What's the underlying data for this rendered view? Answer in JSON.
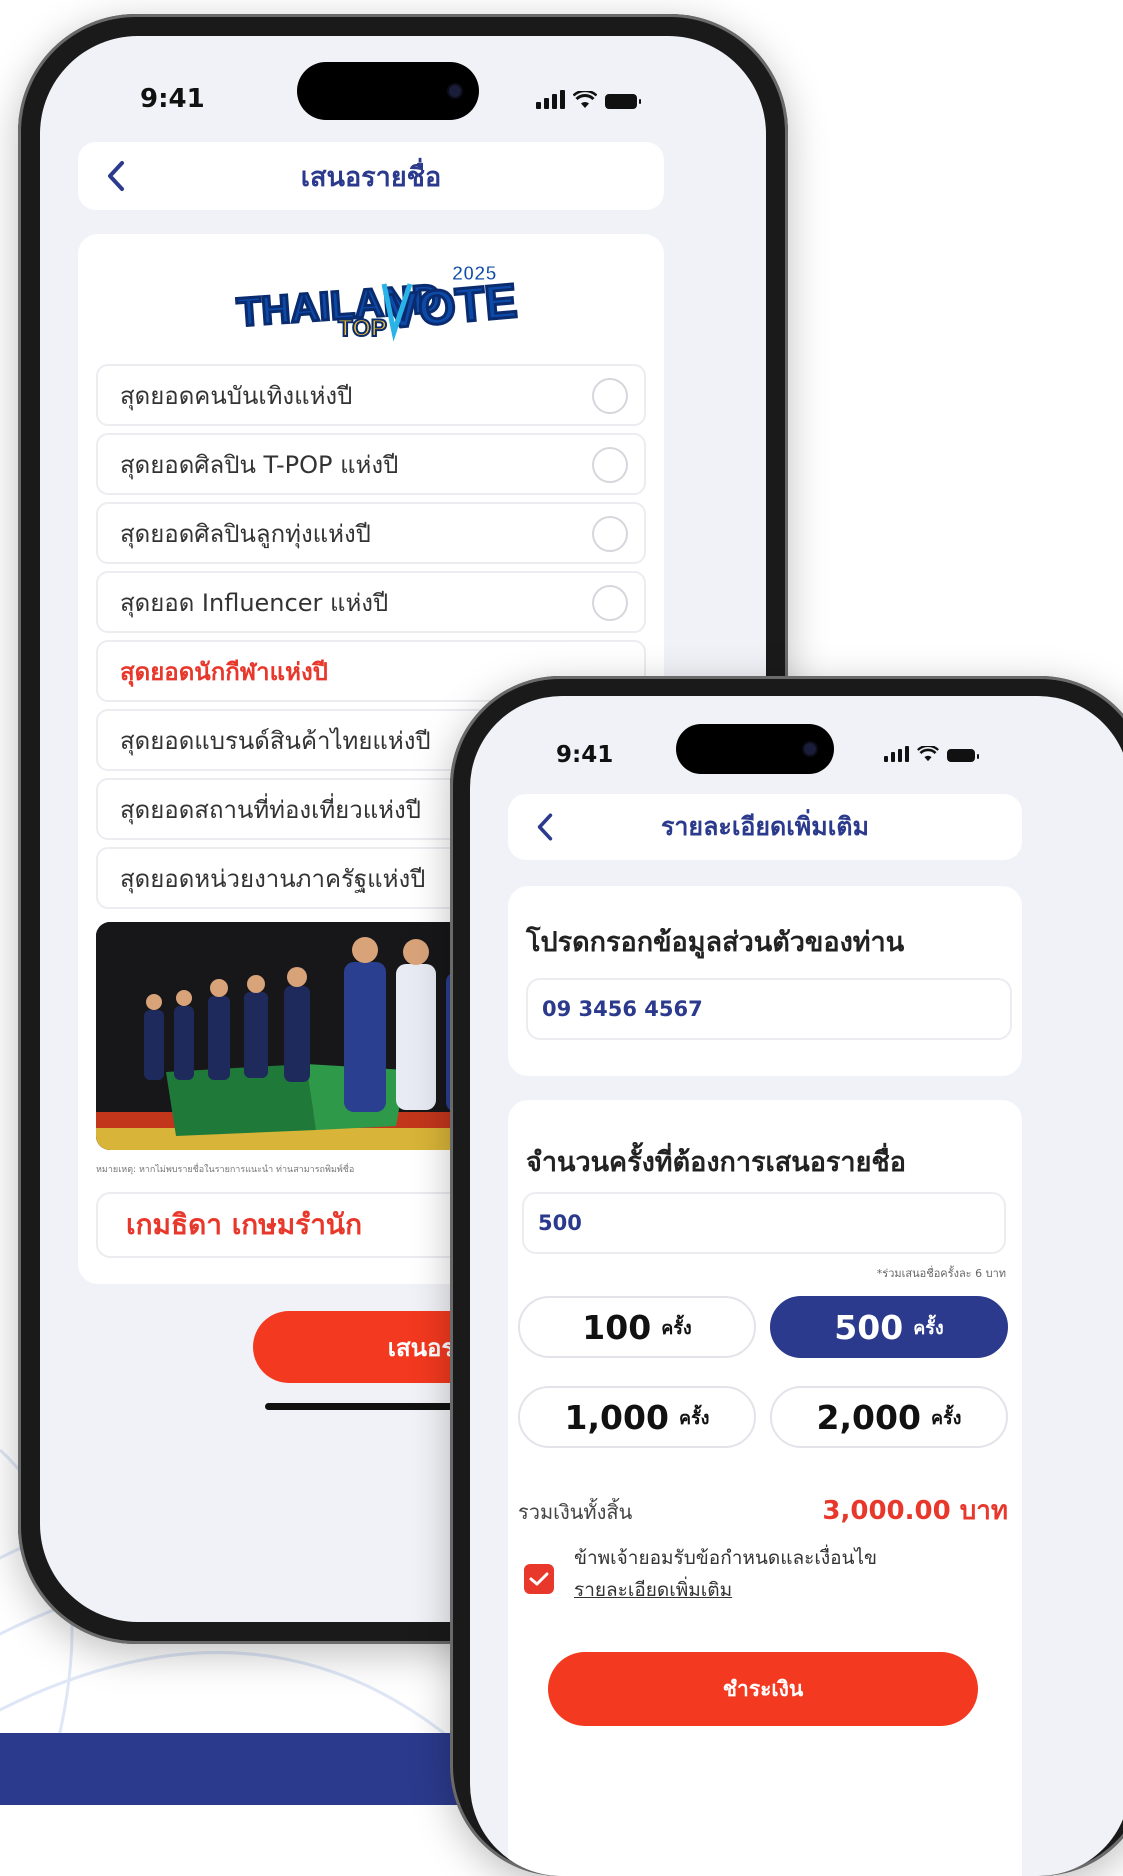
{
  "colors": {
    "navy": "#2b3a8c",
    "red": "#e8372b",
    "button_red": "#f3391f",
    "screen_bg": "#f1f2f7"
  },
  "phone1": {
    "status": {
      "time": "9:41"
    },
    "header": {
      "title": "เสนอรายชื่อ"
    },
    "logo": {
      "word1": "THAILAND",
      "word2": "TOP",
      "word3": "VOTE",
      "year": "2025"
    },
    "categories": [
      {
        "label": "สุดยอดคนบันเทิงแห่งปี",
        "selected": false
      },
      {
        "label": "สุดยอดศิลปิน T-POP แห่งปี",
        "selected": false
      },
      {
        "label": "สุดยอดศิลปินลูกทุ่งแห่งปี",
        "selected": false
      },
      {
        "label": "สุดยอด Influencer แห่งปี",
        "selected": false
      },
      {
        "label": "สุดยอดนักกีฬาแห่งปี",
        "selected": true
      },
      {
        "label": "สุดยอดแบรนด์สินค้าไทยแห่งปี",
        "selected": false
      },
      {
        "label": "สุดยอดสถานที่ท่องเที่ยวแห่งปี",
        "selected": false
      },
      {
        "label": "สุดยอดหน่วยงานภาครัฐแห่งปี",
        "selected": false
      }
    ],
    "note": "หมายเหตุ: หากไม่พบรายชื่อในรายการแนะนำ ท่านสามารถพิมพ์ชื่อ",
    "name_value": "เกมธิดา เกษมรำนัก",
    "submit_label": "เสนอรายชื่"
  },
  "phone2": {
    "status": {
      "time": "9:41"
    },
    "header": {
      "title": "รายละเอียดเพิ่มเติม"
    },
    "personal": {
      "title": "โปรดกรอกข้อมูลส่วนตัวของท่าน",
      "phone_value": "09 3456 4567"
    },
    "count": {
      "title": "จำนวนครั้งที่ต้องการเสนอรายชื่อ",
      "value": "500",
      "hint": "*ร่วมเสนอชื่อครั้งละ 6 บาท",
      "unit": "ครั้ง",
      "options": [
        "100",
        "500",
        "1,000",
        "2,000"
      ],
      "selected": "500"
    },
    "total": {
      "label": "รวมเงินทั้งสิ้น",
      "value": "3,000.00 บาท"
    },
    "terms": {
      "checked": true,
      "text": "ข้าพเจ้ายอมรับข้อกำหนดและเงื่อนไข",
      "link": "รายละเอียดเพิ่มเติม"
    },
    "pay_label": "ชำระเงิน"
  }
}
